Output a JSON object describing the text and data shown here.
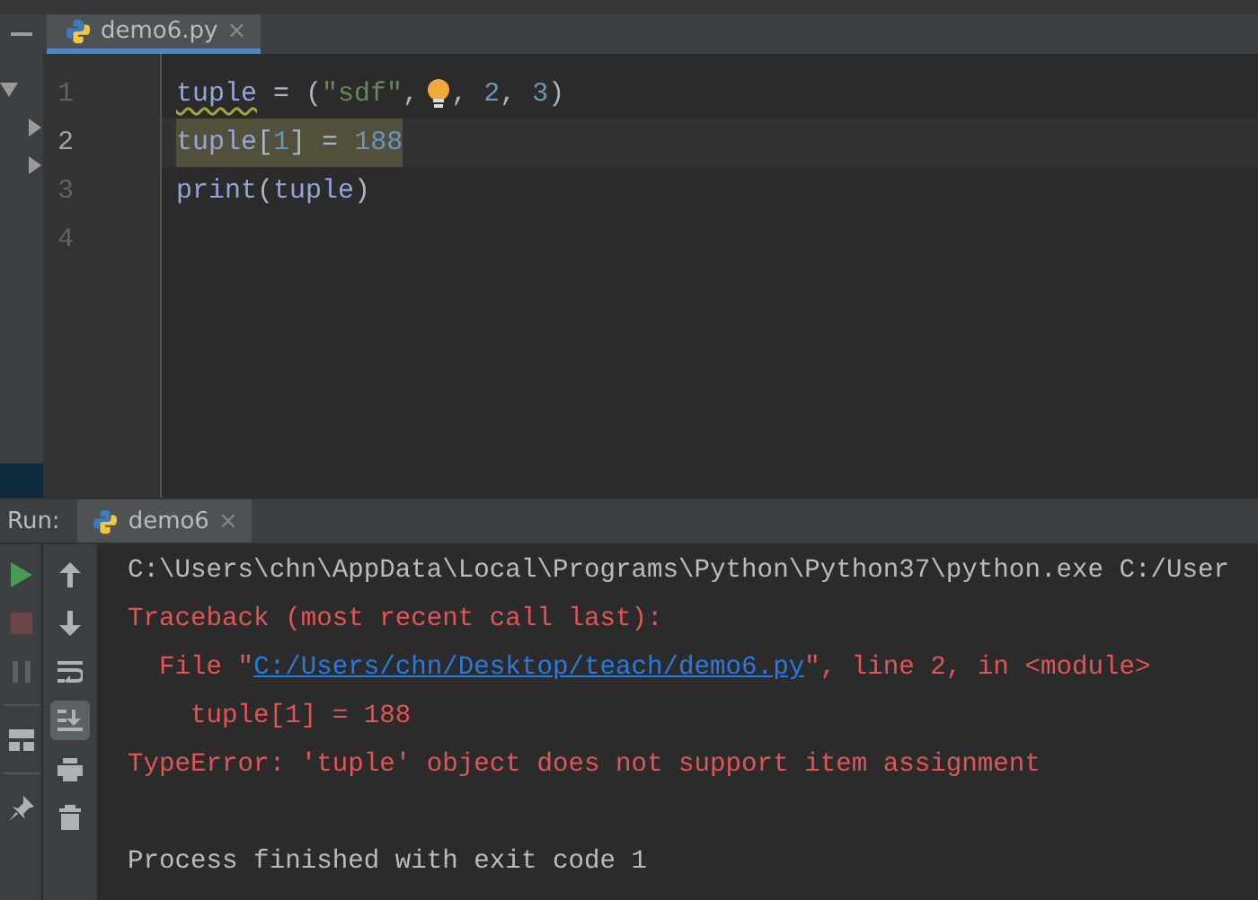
{
  "editor_tabs": [
    {
      "label": "demo6.py",
      "selected": true,
      "close_glyph": "×"
    }
  ],
  "project_tree": {
    "nodes": [
      {
        "expanded": true
      },
      {
        "expanded": false
      },
      {
        "expanded": false
      }
    ]
  },
  "editor": {
    "lines": [
      {
        "number": "1",
        "selected": false,
        "tokens": [
          {
            "kind": "warned-name",
            "text": "tuple"
          },
          {
            "kind": "op",
            "text": " = ("
          },
          {
            "kind": "string",
            "text": "\"sdf\""
          },
          {
            "kind": "op",
            "text": ","
          },
          {
            "kind": "bulb"
          },
          {
            "kind": "op",
            "text": ", "
          },
          {
            "kind": "number",
            "text": "2"
          },
          {
            "kind": "op",
            "text": ", "
          },
          {
            "kind": "number",
            "text": "3"
          },
          {
            "kind": "op",
            "text": ")"
          }
        ]
      },
      {
        "number": "2",
        "selected": true,
        "tokens": [
          {
            "kind": "name",
            "text": "tuple"
          },
          {
            "kind": "op",
            "text": "["
          },
          {
            "kind": "number",
            "text": "1"
          },
          {
            "kind": "op",
            "text": "] = "
          },
          {
            "kind": "number",
            "text": "188"
          }
        ]
      },
      {
        "number": "3",
        "selected": false,
        "tokens": [
          {
            "kind": "builtin",
            "text": "print"
          },
          {
            "kind": "op",
            "text": "("
          },
          {
            "kind": "name",
            "text": "tuple"
          },
          {
            "kind": "op",
            "text": ")"
          }
        ]
      },
      {
        "number": "4",
        "selected": false
      }
    ]
  },
  "run_panel": {
    "label": "Run:",
    "tabs": [
      {
        "label": "demo6",
        "selected": true,
        "close_glyph": "×"
      }
    ],
    "run_controls": [
      {
        "kind": "rerun",
        "disabled": false
      },
      {
        "kind": "stop",
        "disabled": true
      },
      {
        "kind": "pause",
        "disabled": true
      },
      {
        "kind": "layout",
        "disabled": false
      },
      {
        "kind": "pin",
        "disabled": false
      }
    ],
    "console_tools": [
      {
        "kind": "up",
        "selected": false
      },
      {
        "kind": "down",
        "selected": false
      },
      {
        "kind": "wrap",
        "selected": false
      },
      {
        "kind": "scroll-end",
        "selected": true
      },
      {
        "kind": "print",
        "selected": false
      },
      {
        "kind": "trash",
        "selected": false
      }
    ],
    "console": [
      {
        "kind": "output",
        "segments": [
          {
            "kind": "plain",
            "text": "C:\\Users\\chn\\AppData\\Local\\Programs\\Python\\Python37\\python.exe C:/User"
          }
        ]
      },
      {
        "kind": "output",
        "segments": [
          {
            "kind": "error",
            "text": "Traceback (most recent call last):"
          }
        ]
      },
      {
        "kind": "output",
        "segments": [
          {
            "kind": "error",
            "text": "  File \""
          },
          {
            "kind": "link",
            "text": "C:/Users/chn/Desktop/teach/demo6.py"
          },
          {
            "kind": "error",
            "text": "\", line 2, in <module>"
          }
        ]
      },
      {
        "kind": "output",
        "segments": [
          {
            "kind": "error",
            "text": "    tuple[1] = 188"
          }
        ]
      },
      {
        "kind": "output",
        "segments": [
          {
            "kind": "error",
            "text": "TypeError: 'tuple' object does not support item assignment"
          }
        ]
      },
      {
        "kind": "exit",
        "segments": [
          {
            "kind": "plain",
            "text": "Process finished with exit code 1"
          }
        ]
      }
    ]
  }
}
